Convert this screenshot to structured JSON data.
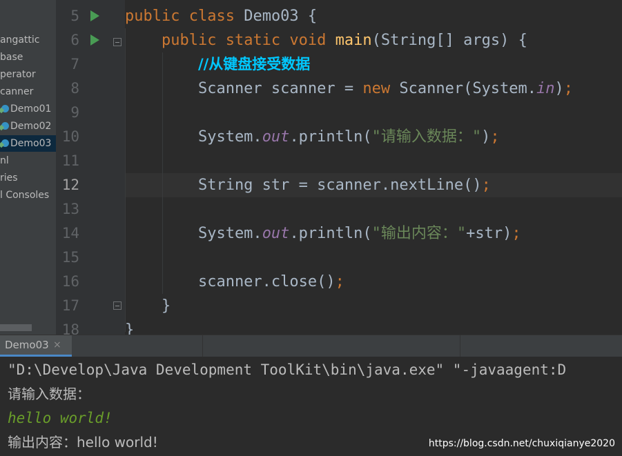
{
  "sidebar": {
    "items": [
      {
        "label": "angattic"
      },
      {
        "label": "base"
      },
      {
        "label": "perator"
      },
      {
        "label": "canner"
      },
      {
        "label": "Demo01"
      },
      {
        "label": "Demo02"
      },
      {
        "label": "Demo03"
      },
      {
        "label": "nl"
      },
      {
        "label": "ries"
      },
      {
        "label": "l Consoles"
      }
    ]
  },
  "editor": {
    "current_line": "12",
    "lines": [
      {
        "num": "5",
        "parts": [
          {
            "t": "public ",
            "c": "kw"
          },
          {
            "t": "class ",
            "c": "kw"
          },
          {
            "t": "Demo03 {",
            "c": "cls"
          }
        ]
      },
      {
        "num": "6",
        "parts": [
          {
            "t": "    public ",
            "c": "kw"
          },
          {
            "t": "static ",
            "c": "kw"
          },
          {
            "t": "void ",
            "c": "kw"
          },
          {
            "t": "main",
            "c": "method"
          },
          {
            "t": "(String[] args) {",
            "c": "cls"
          }
        ]
      },
      {
        "num": "7",
        "parts": [
          {
            "t": "        ",
            "c": "cls"
          },
          {
            "t": "//从键盘接受数据",
            "c": "comment"
          }
        ]
      },
      {
        "num": "8",
        "parts": [
          {
            "t": "        Scanner scanner = ",
            "c": "cls"
          },
          {
            "t": "new ",
            "c": "kw"
          },
          {
            "t": "Scanner(System.",
            "c": "cls"
          },
          {
            "t": "in",
            "c": "field"
          },
          {
            "t": ")",
            "c": "cls"
          },
          {
            "t": ";",
            "c": "kw"
          }
        ]
      },
      {
        "num": "9",
        "parts": []
      },
      {
        "num": "10",
        "parts": [
          {
            "t": "        System.",
            "c": "cls"
          },
          {
            "t": "out",
            "c": "field"
          },
          {
            "t": ".println(",
            "c": "cls"
          },
          {
            "t": "\"请输入数据：\"",
            "c": "str"
          },
          {
            "t": ")",
            "c": "cls"
          },
          {
            "t": ";",
            "c": "kw"
          }
        ]
      },
      {
        "num": "11",
        "parts": []
      },
      {
        "num": "12",
        "parts": [
          {
            "t": "        String str = scanner.nextLine()",
            "c": "cls"
          },
          {
            "t": ";",
            "c": "kw"
          }
        ]
      },
      {
        "num": "13",
        "parts": []
      },
      {
        "num": "14",
        "parts": [
          {
            "t": "        System.",
            "c": "cls"
          },
          {
            "t": "out",
            "c": "field"
          },
          {
            "t": ".println(",
            "c": "cls"
          },
          {
            "t": "\"输出内容：\"",
            "c": "str"
          },
          {
            "t": "+str)",
            "c": "cls"
          },
          {
            "t": ";",
            "c": "kw"
          }
        ]
      },
      {
        "num": "15",
        "parts": []
      },
      {
        "num": "16",
        "parts": [
          {
            "t": "        scanner.close()",
            "c": "cls"
          },
          {
            "t": ";",
            "c": "kw"
          }
        ]
      },
      {
        "num": "17",
        "parts": [
          {
            "t": "    }",
            "c": "cls"
          }
        ]
      },
      {
        "num": "18",
        "parts": [
          {
            "t": "}",
            "c": "cls"
          }
        ]
      }
    ]
  },
  "run_panel": {
    "tab_label": "Demo03",
    "tab_close": "×",
    "console_lines": [
      {
        "text": "\"D:\\Develop\\Java Development ToolKit\\bin\\java.exe\" \"-javaagent:D",
        "kind": "cmd"
      },
      {
        "text": "请输入数据：",
        "kind": "cjk"
      },
      {
        "text": "hello world!",
        "kind": "input"
      },
      {
        "text": "输出内容：hello world!",
        "kind": "cjk"
      }
    ]
  },
  "watermark": "https://blog.csdn.net/chuxiqianye2020"
}
